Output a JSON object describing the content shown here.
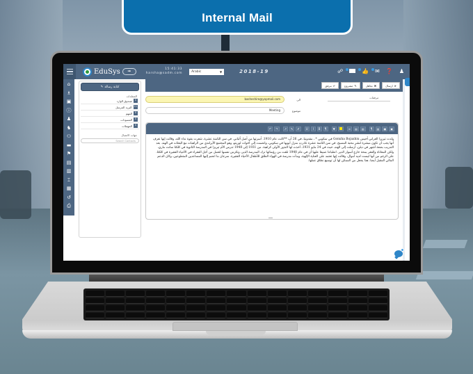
{
  "banner": {
    "title": "Internal Mail"
  },
  "app": {
    "logo_text": "EduSys",
    "logo_pill": "➟",
    "clock_time": "15:41:33",
    "user_email": "harsha@sadm.com",
    "language": "Arabic",
    "academic_year": "2018-19",
    "top_icons": [
      {
        "name": "link-icon",
        "glyph": "☍",
        "badge": false
      },
      {
        "name": "id-card-icon",
        "glyph": "",
        "badge": true
      },
      {
        "name": "thumbs-up-icon",
        "glyph": "👍",
        "badge": true
      },
      {
        "name": "mail-icon",
        "glyph": "✉",
        "badge": true
      },
      {
        "name": "help-icon",
        "glyph": "❓",
        "badge": false
      },
      {
        "name": "user-icon",
        "glyph": "♟",
        "badge": false
      }
    ]
  },
  "rail": [
    {
      "name": "home-icon",
      "glyph": "⌂"
    },
    {
      "name": "institution-icon",
      "glyph": "♗"
    },
    {
      "name": "monitor-icon",
      "glyph": "▣"
    },
    {
      "name": "info-icon",
      "glyph": "ⓘ"
    },
    {
      "name": "user-icon",
      "glyph": "♟"
    },
    {
      "name": "user-add-icon",
      "glyph": "♞"
    },
    {
      "name": "group-icon",
      "glyph": "⚇"
    },
    {
      "name": "card-icon",
      "glyph": "▬"
    },
    {
      "name": "flag-icon",
      "glyph": "⚑"
    },
    {
      "name": "document-icon",
      "glyph": "▤"
    },
    {
      "name": "book-icon",
      "glyph": "▥"
    },
    {
      "name": "bed-icon",
      "glyph": "⌶"
    },
    {
      "name": "bus-icon",
      "glyph": "▦"
    },
    {
      "name": "history-icon",
      "glyph": "↺"
    },
    {
      "name": "print-icon",
      "glyph": "⎙"
    }
  ],
  "folders": {
    "compose_label": "كتابة رسالة",
    "title": "المجلدات",
    "items": [
      {
        "label": "صندوق الوارد",
        "count": "0"
      },
      {
        "label": "البريد المرسل",
        "count": "11"
      },
      {
        "label": "المهم",
        "count": "0"
      },
      {
        "label": "المسودات",
        "count": "0"
      },
      {
        "label": "المهملات",
        "count": "0"
      }
    ],
    "contacts_title": "جهات الاتصال",
    "contacts_placeholder": "Search Contacts"
  },
  "compose": {
    "title": "كتابة رسالة",
    "buttons": [
      {
        "label": "ارسال",
        "icon": "send-icon",
        "glyph": "➤"
      },
      {
        "label": "تجاهل",
        "icon": "close-icon",
        "glyph": "✖"
      },
      {
        "label": "مشروع",
        "icon": "pencil-icon",
        "glyph": "✎"
      },
      {
        "label": "مرفق",
        "icon": "paperclip-icon",
        "glyph": "✐"
      }
    ],
    "to_label": "الى",
    "to_value": "basheshire@yopmail.com",
    "subject_label": "موضوع",
    "subject_value": "Meeting",
    "attachments_label": "مرفقات"
  },
  "editor": {
    "toolbar": [
      "↶",
      "↷",
      "↗",
      "✎",
      "✐",
      "U",
      "I",
      "B",
      "¶",
      "▼",
      "■",
      "≡",
      "▤",
      "▤",
      "¶",
      "▤",
      "▣",
      "▣"
    ],
    "body": "ولدت تيريزا العرابي أخيس Gonxha Bojaxhiu في سكوبي * ، مقدونيا، في 26 أب **كانت عام 1910. أسرتها من أصل ألباني. في سن الثامنة عشرة، شعرت بقوة نداء الله، وقالت إنها تعرف أنها يجب أن تكون مبشرة لنشر محبة المسيح. في سن الثامنة عشرة غادرت منزل أبويها في سكوبي، وانضمت إلى أخوات لوريتو، وهو المجتمع الأيرلندي من الراهبات مع البعثات في الهند. بعد التدريب بضعة أشهر في دبلن، أرسلت إلى الهند، حيث في 24 مايو 1931، أخذت لها النذور الأولى كراهبة. من 1931 إلى 1948 تدرس الأم تيريزا في المدرسة الثانوية في كلكتا سانت ماري، ولكن المعاناة والفقر بمحة خارج أسوار الدير. انطباعا عميقا عليها أن في عام 1948 تلقت من رؤسائها ترك المدرسة الدير، وتكرس نفسها لتعمل من أجل الفقراء في الأحياء الفقيرة في كلكتا. على الرغم من أنها ليست لديه أموال، وقالت إنها تعتمد على العناية الإلهية، وبدأت مدرسة في الهواء الطلق للأطفال الأحياء الفقيرة. سرعان ما انضم إليها المساعدين المتطوعين، وكان الدعم المالي المقبل أيضا. هذا يجعل من الممكن لها أن توسيع نطاق عملها."
  }
}
